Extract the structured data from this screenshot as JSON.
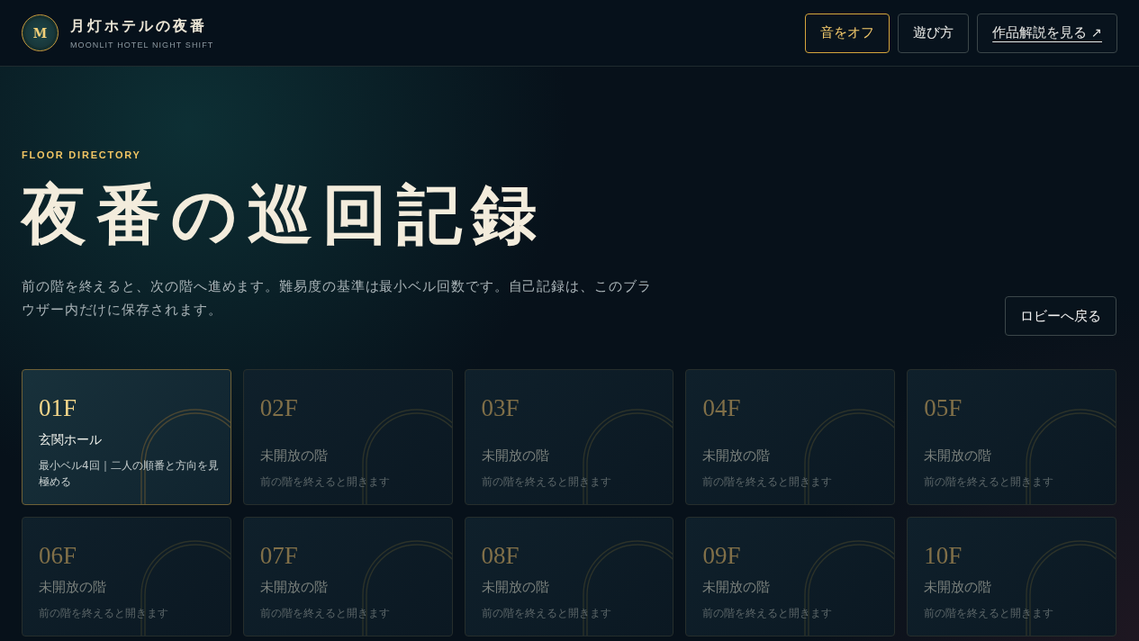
{
  "header": {
    "logo_letter": "M",
    "title": "月灯ホテルの夜番",
    "subtitle": "MOONLIT HOTEL NIGHT SHIFT",
    "buttons": [
      {
        "kind": "toggle",
        "label": "音をオフ",
        "on": true
      },
      {
        "kind": "button",
        "label": "遊び方"
      },
      {
        "kind": "link",
        "label": "作品解説を見る ↗"
      }
    ]
  },
  "hero": {
    "eyebrow": "FLOOR DIRECTORY",
    "title": "夜番の巡回記録",
    "description": "前の階を終えると、次の階へ進めます。難易度の基準は最小ベル回数です。自己記録は、このブラウザー内だけに保存されます。",
    "back_button": "ロビーへ戻る"
  },
  "floors": [
    {
      "number": "01F",
      "name": "玄関ホール",
      "description": "最小ベル4回｜二人の順番と方向を見極める",
      "locked": false
    },
    {
      "number": "02F",
      "name": "未開放の階",
      "description": "前の階を終えると開きます",
      "locked": true
    },
    {
      "number": "03F",
      "name": "未開放の階",
      "description": "前の階を終えると開きます",
      "locked": true
    },
    {
      "number": "04F",
      "name": "未開放の階",
      "description": "前の階を終えると開きます",
      "locked": true
    },
    {
      "number": "05F",
      "name": "未開放の階",
      "description": "前の階を終えると開きます",
      "locked": true
    },
    {
      "number": "06F",
      "name": "未開放の階",
      "description": "前の階を終えると開きます",
      "locked": true
    },
    {
      "number": "07F",
      "name": "未開放の階",
      "description": "前の階を終えると開きます",
      "locked": true
    },
    {
      "number": "08F",
      "name": "未開放の階",
      "description": "前の階を終えると開きます",
      "locked": true
    },
    {
      "number": "09F",
      "name": "未開放の階",
      "description": "前の階を終えると開きます",
      "locked": true
    },
    {
      "number": "10F",
      "name": "未開放の階",
      "description": "前の階を終えると開きます",
      "locked": true
    }
  ]
}
